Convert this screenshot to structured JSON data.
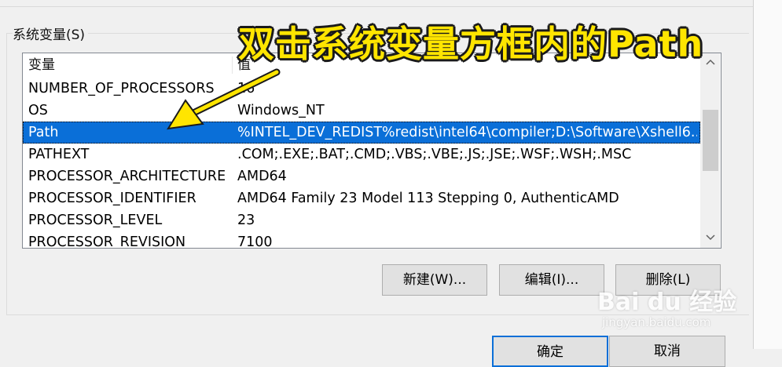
{
  "group_label": "系统变量(S)",
  "columns": [
    "变量",
    "值"
  ],
  "rows": [
    {
      "name": "NUMBER_OF_PROCESSORS",
      "value": "16"
    },
    {
      "name": "OS",
      "value": "Windows_NT"
    },
    {
      "name": "Path",
      "value": "%INTEL_DEV_REDIST%redist\\intel64\\compiler;D:\\Software\\Xshell6..."
    },
    {
      "name": "PATHEXT",
      "value": ".COM;.EXE;.BAT;.CMD;.VBS;.VBE;.JS;.JSE;.WSF;.WSH;.MSC"
    },
    {
      "name": "PROCESSOR_ARCHITECTURE",
      "value": "AMD64"
    },
    {
      "name": "PROCESSOR_IDENTIFIER",
      "value": "AMD64 Family 23 Model 113 Stepping 0, AuthenticAMD"
    },
    {
      "name": "PROCESSOR_LEVEL",
      "value": "23"
    },
    {
      "name": "PROCESSOR_REVISION",
      "value": "7100"
    }
  ],
  "selected_row": "Path",
  "buttons": {
    "new": "新建(W)...",
    "edit": "编辑(I)...",
    "delete": "删除(L)"
  },
  "dialog_buttons": {
    "ok": "确定",
    "cancel": "取消"
  },
  "annotation": "双击系统变量方框内的Path",
  "watermark": {
    "brand": "Bai du 经验",
    "url": "jingyan.baidu.com"
  },
  "colors": {
    "selection": "#0a6fd8",
    "annotation": "#ffe500",
    "arrow": "#ffe500"
  },
  "icons": {
    "scroll_up": "chevron-up-icon",
    "scroll_down": "chevron-down-icon"
  }
}
